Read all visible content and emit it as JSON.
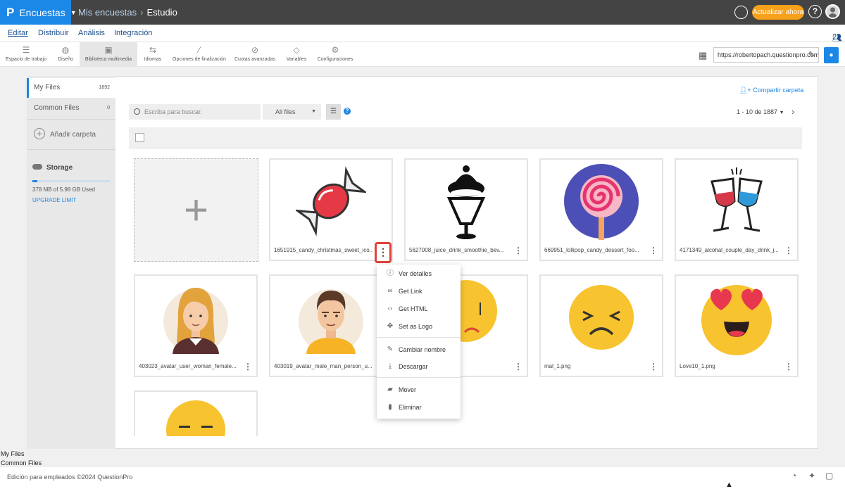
{
  "app": {
    "name": "Encuestas",
    "logo": "P"
  },
  "breadcrumb": {
    "parent": "Mis encuestas",
    "current": "Estudio"
  },
  "topbar": {
    "upgrade_label": "Actualizar ahora",
    "help_label": "?"
  },
  "nav": {
    "tabs": [
      "Editar",
      "Distribuir",
      "Análisis",
      "Integración"
    ],
    "collaborators": "2"
  },
  "toolbar": {
    "items": [
      "Espacio de trabajo",
      "Diseño",
      "Biblioteca multimedia",
      "Idiomas",
      "Opciones de finalización",
      "Cuotas avanzadas",
      "Variables",
      "Configuraciones"
    ],
    "selected": "Biblioteca multimedia"
  },
  "url": {
    "value": "https://robertopach.questionpro.com"
  },
  "sidebar": {
    "my_files": "My Files",
    "my_files_count": "1892",
    "common_files": "Common Files",
    "common_files_count": "0",
    "add_folder": "Añadir carpeta",
    "storage_title": "Storage",
    "storage_used": "378 MB of 5.98 GB Used",
    "storage_fraction": 0.063,
    "upgrade_limit": "UPGRADE LIMIT"
  },
  "library": {
    "share_folder": "Compartir carpeta",
    "search_placeholder": "Escriba para buscar.",
    "filter": "All files",
    "pagination": "1 - 10 de 1887"
  },
  "files": [
    {
      "name": "1651915_candy_christmas_sweet_ico..."
    },
    {
      "name": "5627008_juice_drink_smoothie_bev..."
    },
    {
      "name": "669951_lollipop_candy_dessert_foo..."
    },
    {
      "name": "4171349_alcohal_couple_day_drink_j..."
    },
    {
      "name": "403023_avatar_user_woman_female..."
    },
    {
      "name": "403019_avatar_male_man_person_u..."
    },
    {
      "name": ""
    },
    {
      "name": "mal_1.png"
    },
    {
      "name": "Love10_1.png"
    }
  ],
  "context_menu": [
    "Ver detalles",
    "Get Link",
    "Get HTML",
    "Set as Logo",
    "Cambiar nombre",
    "Descargar",
    "Mover",
    "Eliminar"
  ],
  "bottom_labels": [
    "My Files",
    "Common Files"
  ],
  "footer": {
    "text": "Edición para empleados ©2024 QuestionPro"
  },
  "colors": {
    "brand": "#1b87e6",
    "upgrade": "#f7a11a",
    "highlight": "#e0433c",
    "topbar": "#444444"
  }
}
